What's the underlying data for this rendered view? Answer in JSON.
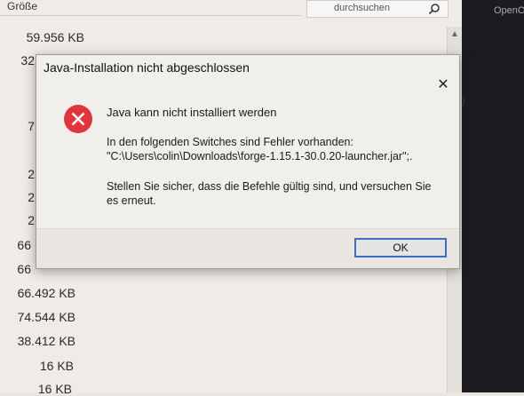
{
  "explorer": {
    "column_header": "Größe",
    "search_placeholder": "durchsuchen",
    "sizes": [
      "59.956 KB",
      "32",
      "7",
      "2",
      "2",
      "2",
      "66",
      "66",
      "66.492 KB",
      "74.544 KB",
      "38.412 KB",
      "16 KB",
      "16 KB"
    ]
  },
  "right_panel": {
    "text": "OpenO",
    "stray": ")"
  },
  "dialog": {
    "title": "Java-Installation nicht abgeschlossen",
    "close_glyph": "✕",
    "heading": "Java kann nicht installiert werden",
    "message_line1": "In den folgenden Switches sind Fehler vorhanden:",
    "message_line2": "\"C:\\Users\\colin\\Downloads\\forge-1.15.1-30.0.20-launcher.jar\";.",
    "message_line3": "Stellen Sie sicher, dass die Befehle gültig sind, und versuchen Sie es erneut.",
    "ok_label": "OK"
  },
  "colors": {
    "accent": "#3a6fc4",
    "error": "#e0353b"
  }
}
